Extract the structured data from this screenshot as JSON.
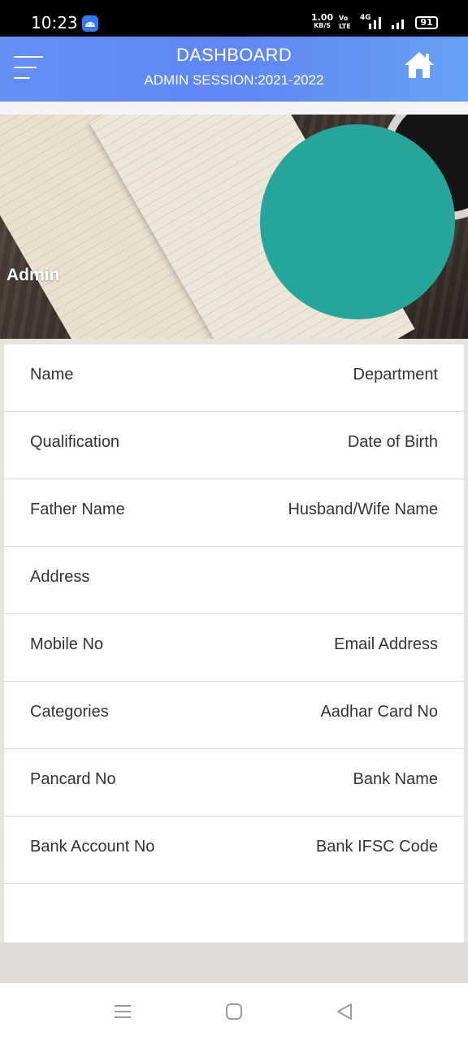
{
  "status_bar": {
    "time": "10:23",
    "net_speed": "1.00",
    "net_speed_unit": "KB/S",
    "volte_top": "Vo",
    "volte_bottom": "LTE",
    "network": "4G",
    "battery": "91",
    "app_icon": "android-icon"
  },
  "header": {
    "title": "DASHBOARD",
    "subtitle": "ADMIN SESSION:2021-2022",
    "menu_icon": "menu-icon",
    "home_icon": "home-icon",
    "color": "#6490f6"
  },
  "profile": {
    "name": "Admin",
    "avatar_color": "#26a69a"
  },
  "details": [
    {
      "left": "Name",
      "right": "Department"
    },
    {
      "left": "Qualification",
      "right": "Date of Birth"
    },
    {
      "left": "Father Name",
      "right": "Husband/Wife Name"
    },
    {
      "left": "Address",
      "right": ""
    },
    {
      "left": "Mobile No",
      "right": "Email Address"
    },
    {
      "left": "Categories",
      "right": "Aadhar Card No"
    },
    {
      "left": "Pancard No",
      "right": "Bank Name"
    },
    {
      "left": "Bank Account No",
      "right": "Bank IFSC Code"
    }
  ],
  "nav_bar": {
    "recents_icon": "recents-icon",
    "home_icon": "home-circle-icon",
    "back_icon": "back-icon"
  }
}
